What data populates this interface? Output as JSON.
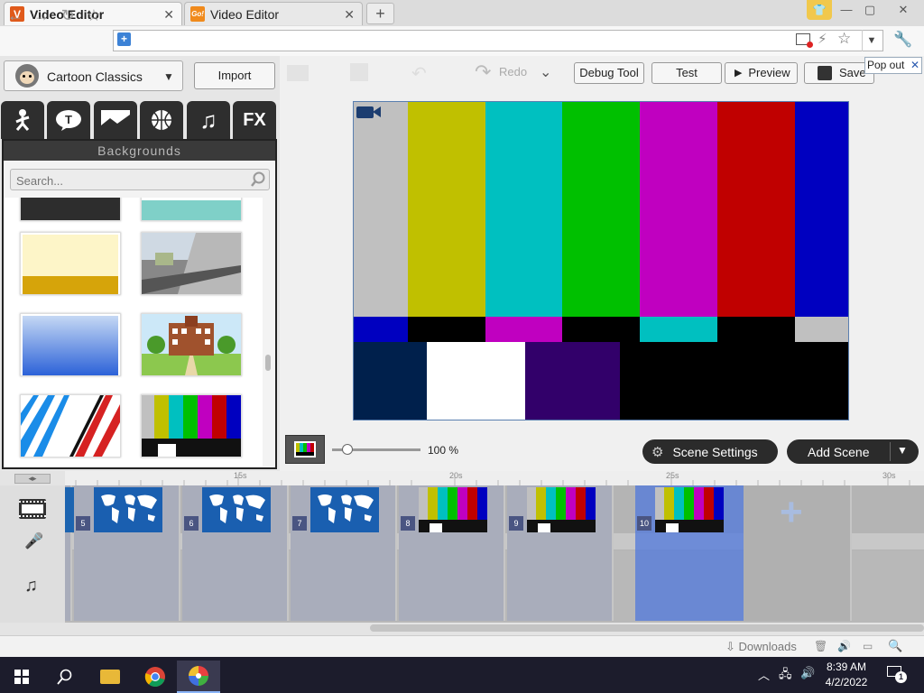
{
  "browser": {
    "tabs": [
      {
        "title": "Video Editor",
        "favicon": "V",
        "favicon_color": "#e05a1b",
        "active": true
      },
      {
        "title": "Video Editor",
        "favicon": "Go!",
        "favicon_color": "#f08a1c",
        "active": false
      }
    ],
    "new_tab": "+",
    "window_controls": {
      "minimize": "—",
      "maximize": "▢",
      "close": "✕"
    }
  },
  "editor": {
    "theme_selector": "Cartoon Classics",
    "import_label": "Import",
    "category_tabs": [
      "character",
      "text",
      "background",
      "prop",
      "music",
      "FX"
    ],
    "panel_title": "Backgrounds",
    "search_placeholder": "Search...",
    "toolbar": {
      "redo": "Redo",
      "debug": "Debug Tool",
      "test": "Test",
      "preview": "Preview",
      "save": "Save",
      "popout": "Pop out",
      "popout_close": "✕"
    },
    "zoom": "100 %",
    "scene_settings": "Scene Settings",
    "add_scene": "Add Scene",
    "ruler_labels": [
      "15s",
      "20s",
      "25s",
      "30s"
    ],
    "scenes": [
      {
        "num": "",
        "thumb": "world-map"
      },
      {
        "num": "5",
        "thumb": "world-map"
      },
      {
        "num": "6",
        "thumb": "world-map"
      },
      {
        "num": "7",
        "thumb": "world-map"
      },
      {
        "num": "8",
        "thumb": "color-bars"
      },
      {
        "num": "9",
        "thumb": "color-bars"
      },
      {
        "num": "10",
        "thumb": "color-bars"
      }
    ],
    "selected_scene": "10"
  },
  "status": {
    "downloads": "Downloads"
  },
  "taskbar": {
    "time": "8:39 AM",
    "date": "4/2/2022",
    "notification_count": "1"
  }
}
